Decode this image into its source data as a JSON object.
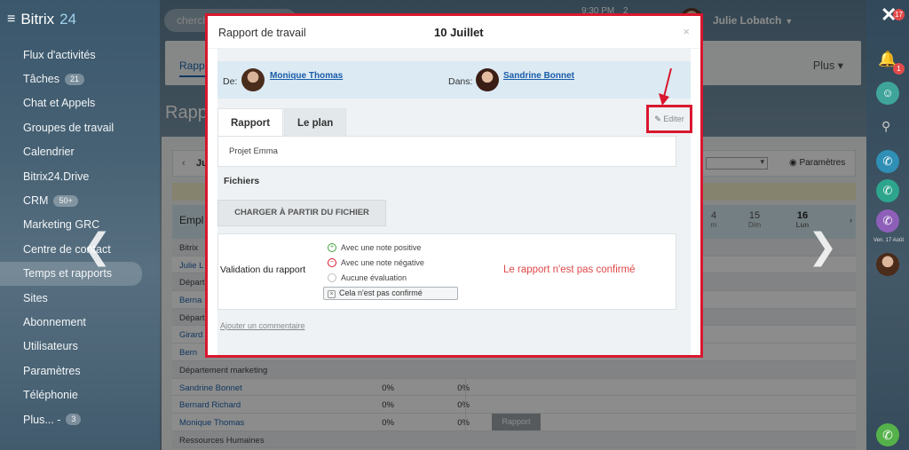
{
  "sidebar": {
    "brand": "Bitrix",
    "brand_num": "24",
    "items": [
      {
        "label": "Flux d'activités"
      },
      {
        "label": "Tâches",
        "badge": "21"
      },
      {
        "label": "Chat et Appels"
      },
      {
        "label": "Groupes de travail"
      },
      {
        "label": "Calendrier"
      },
      {
        "label": "Bitrix24.Drive"
      },
      {
        "label": "CRM",
        "badge": "50+"
      },
      {
        "label": "Marketing GRC"
      },
      {
        "label": "Centre de contact"
      },
      {
        "label": "Temps et rapports"
      },
      {
        "label": "Sites"
      },
      {
        "label": "Abonnement"
      },
      {
        "label": "Utilisateurs"
      },
      {
        "label": "Paramètres"
      },
      {
        "label": "Téléphonie"
      },
      {
        "label": "Plus... -",
        "badge": "3"
      }
    ]
  },
  "topbar": {
    "search_placeholder": "cherch",
    "clock": "9:30 PM",
    "count": "2",
    "user_name": "Julie Lobatch"
  },
  "content": {
    "tab_label": "Rapp",
    "more_label": "Plus",
    "page_title": "Rapp",
    "filter_month": "Ju",
    "params_label": "Paramètres",
    "employees_header": "Empl",
    "days": [
      {
        "num": "4",
        "sub": "m"
      },
      {
        "num": "15",
        "sub": "Dim"
      },
      {
        "num": "16",
        "sub": "Lun"
      }
    ],
    "rows": [
      {
        "label": "Bitrix",
        "type": "dept"
      },
      {
        "label": "Julie L",
        "type": "person"
      },
      {
        "label": "Départe",
        "type": "dept"
      },
      {
        "label": "Berna",
        "type": "person"
      },
      {
        "label": "Départ",
        "type": "dept"
      },
      {
        "label": "Girard",
        "type": "person"
      },
      {
        "label": "Bern",
        "type": "person"
      },
      {
        "label": "Département marketing",
        "type": "dept"
      },
      {
        "label": "Sandrine Bonnet",
        "type": "person",
        "p1": "0%",
        "p2": "0%"
      },
      {
        "label": "Bernard Richard",
        "type": "person",
        "p1": "0%",
        "p2": "0%"
      },
      {
        "label": "Monique Thomas",
        "type": "person",
        "p1": "0%",
        "p2": "0%",
        "badge": "Rapport"
      },
      {
        "label": "Ressources Humaines",
        "type": "dept"
      }
    ]
  },
  "rail": {
    "badge_top": "17",
    "badge_notif": "1",
    "caption": "Ven. 17 Août"
  },
  "modal": {
    "title": "Rapport de travail",
    "date": "10 Juillet",
    "close": "×",
    "from_label": "De:",
    "from_name": "Monique Thomas",
    "to_label": "Dans:",
    "to_name": "Sandrine Bonnet",
    "tabs": [
      "Rapport",
      "Le plan"
    ],
    "edit_label": "Editer",
    "report_text": "Projet Emma",
    "files_label": "Fichiers",
    "upload_label": "CHARGER À PARTIR DU FICHIER",
    "validation_label": "Validation du rapport",
    "options": [
      "Avec une note positive",
      "Avec une note négative",
      "Aucune évaluation"
    ],
    "not_confirmed_button": "Cela n'est pas confirmé",
    "status_text": "Le rapport n'est pas confirmé",
    "comment_link": "Ajouter un commentaire"
  }
}
